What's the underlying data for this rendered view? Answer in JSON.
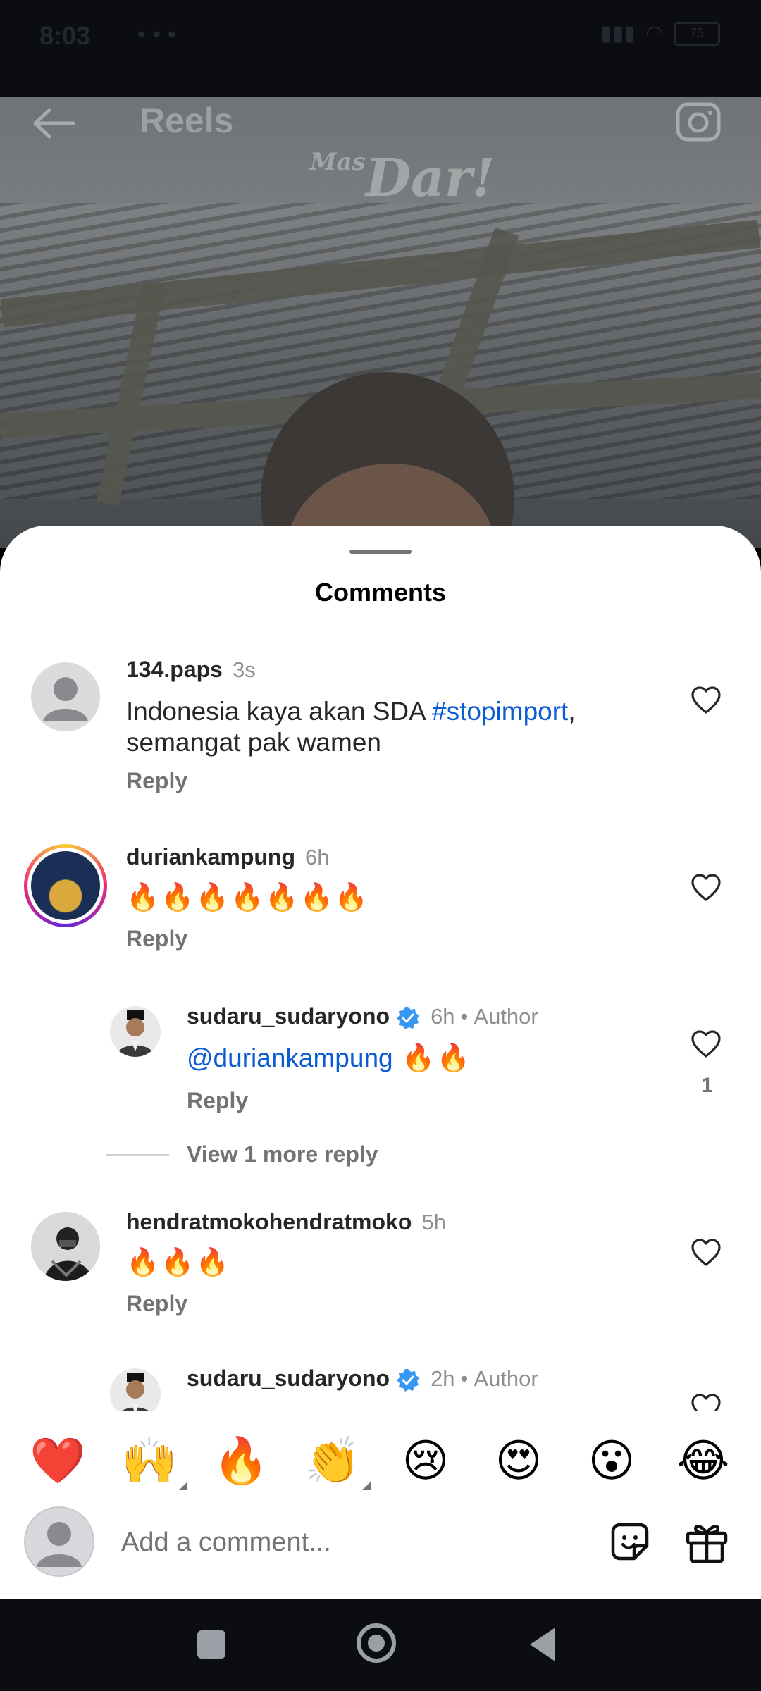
{
  "status_bar": {
    "time": "8:03",
    "extra": "• • •",
    "battery": "75"
  },
  "header": {
    "title": "Reels",
    "watermark_small": "Mas",
    "watermark": "Dar!"
  },
  "sheet": {
    "title": "Comments"
  },
  "comments": [
    {
      "username": "134.paps",
      "time": "3s",
      "text_before": "Indonesia kaya akan SDA ",
      "hashtag": "#stopimport",
      "text_after": ", semangat pak wamen",
      "reply": "Reply"
    },
    {
      "username": "duriankampung",
      "time": "6h",
      "emojis": "🔥🔥🔥🔥🔥🔥🔥",
      "reply": "Reply"
    },
    {
      "username": "sudaru_sudaryono",
      "time": "6h",
      "author_label": "Author",
      "mention": "@duriankampung",
      "emojis": " 🔥🔥",
      "reply": "Reply",
      "likes": "1"
    },
    {
      "username": "hendratmokohendratmoko",
      "time": "5h",
      "emojis": "🔥🔥🔥",
      "reply": "Reply"
    },
    {
      "username": "sudaru_sudaryono",
      "time": "2h",
      "author_label": "Author"
    }
  ],
  "view_more": "View 1 more reply",
  "reactions": [
    "❤️",
    "🙌",
    "🔥",
    "👏",
    "😢",
    "😍",
    "😮",
    "😂"
  ],
  "input": {
    "placeholder": "Add a comment..."
  },
  "colors": {
    "link": "#0b5bd3",
    "verified": "#3897f0",
    "text": "#262626",
    "muted": "#737373"
  }
}
